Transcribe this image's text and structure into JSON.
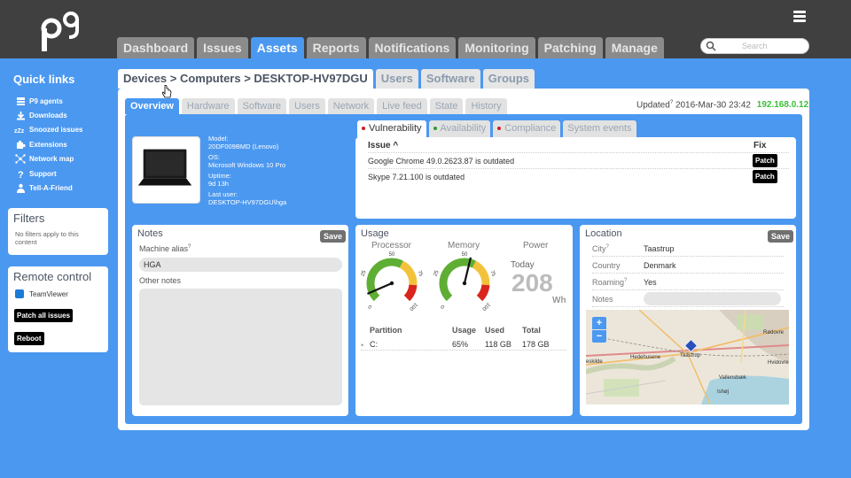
{
  "nav": {
    "tabs": [
      "Dashboard",
      "Issues",
      "Assets",
      "Reports",
      "Notifications",
      "Monitoring",
      "Patching",
      "Manage"
    ],
    "active": "Assets"
  },
  "search": {
    "placeholder": "Search"
  },
  "quick_links": {
    "title": "Quick links",
    "items": [
      {
        "label": "P9 agents",
        "icon": "agents-icon"
      },
      {
        "label": "Downloads",
        "icon": "download-icon"
      },
      {
        "label": "Snoozed issues",
        "icon": "snooze-icon"
      },
      {
        "label": "Extensions",
        "icon": "puzzle-icon"
      },
      {
        "label": "Network map",
        "icon": "network-icon"
      },
      {
        "label": "Support",
        "icon": "question-icon"
      },
      {
        "label": "Tell-A-Friend",
        "icon": "person-icon"
      }
    ]
  },
  "filters": {
    "title": "Filters",
    "empty_text": "No filters apply to this content"
  },
  "remote": {
    "title": "Remote control",
    "teamviewer": "TeamViewer",
    "patch_all": "Patch all issues",
    "reboot": "Reboot"
  },
  "breadcrumb_tabs": {
    "path": "Devices > Computers > DESKTOP-HV97DGU",
    "tabs": [
      "Users",
      "Software",
      "Groups"
    ]
  },
  "subtabs": {
    "items": [
      "Overview",
      "Hardware",
      "Software",
      "Users",
      "Network",
      "Live feed",
      "State",
      "History"
    ],
    "active": "Overview"
  },
  "updated": {
    "label": "Updated",
    "sup": "?",
    "date": "2016-Mar-30 23:42",
    "ip": "192.168.0.12"
  },
  "device": {
    "model_label": "Model:",
    "model": "20DF009BMD (Lenovo)",
    "os_label": "OS:",
    "os": "Microsoft Windows 10 Pro",
    "uptime_label": "Uptime:",
    "uptime": "9d 13h",
    "lastuser_label": "Last user:",
    "lastuser": "DESKTOP-HV97DGU\\hga"
  },
  "vuln_tabs": {
    "items": [
      {
        "label": "Vulnerability",
        "dot": "#cc1f1f"
      },
      {
        "label": "Availability",
        "dot": "#2e9b2e"
      },
      {
        "label": "Compliance",
        "dot": "#cc1f1f"
      },
      {
        "label": "System events",
        "dot": ""
      }
    ],
    "active": "Vulnerability"
  },
  "issues": {
    "col_issue": "Issue",
    "sort_glyph": "^",
    "col_fix": "Fix",
    "rows": [
      {
        "text": "Google Chrome 49.0.2623.87 is outdated",
        "fix": "Patch"
      },
      {
        "text": "Skype 7.21.100 is outdated",
        "fix": "Patch"
      }
    ]
  },
  "notes": {
    "title": "Notes",
    "save": "Save",
    "alias_label": "Machine alias",
    "alias_sup": "?",
    "alias": "HGA",
    "other_label": "Other notes"
  },
  "usage": {
    "title": "Usage",
    "processor_label": "Processor",
    "memory_label": "Memory",
    "power_label": "Power",
    "gauge_ticks": {
      "t25": "25",
      "t50": "50",
      "t75": "75",
      "t100": "100",
      "t0": "0"
    },
    "processor_value": 0.08,
    "memory_value": 0.55,
    "power_period": "Today",
    "power_value": "208",
    "power_unit": "Wh",
    "partition_cols": [
      "Partition",
      "Usage",
      "Used",
      "Total"
    ],
    "partitions": [
      {
        "name": "C:",
        "usage": "65%",
        "used": "118 GB",
        "total": "178 GB"
      }
    ]
  },
  "location": {
    "title": "Location",
    "save": "Save",
    "rows": [
      {
        "key": "City",
        "sup": "?",
        "value": "Taastrup"
      },
      {
        "key": "Country",
        "sup": "",
        "value": "Denmark"
      },
      {
        "key": "Roaming",
        "sup": "?",
        "value": "Yes"
      },
      {
        "key": "Notes",
        "sup": "",
        "value": ""
      }
    ],
    "map_labels": {
      "hedehusene": "Hedehusene",
      "taastrup": "Taastrup",
      "rodovre": "Rødovre",
      "hvidovre": "Hvidovre",
      "vallensbaek": "Vallensbæk",
      "ishoj": "Ishøj",
      "roskilde": "eskilde",
      "zoom_in": "+",
      "zoom_out": "−"
    }
  },
  "colors": {
    "accent": "#4b98f0",
    "topbar": "#404040",
    "ip": "#3bbf3b",
    "gauge_green": "#5fae34",
    "gauge_yellow": "#f2c33a",
    "gauge_red": "#d9251d"
  }
}
